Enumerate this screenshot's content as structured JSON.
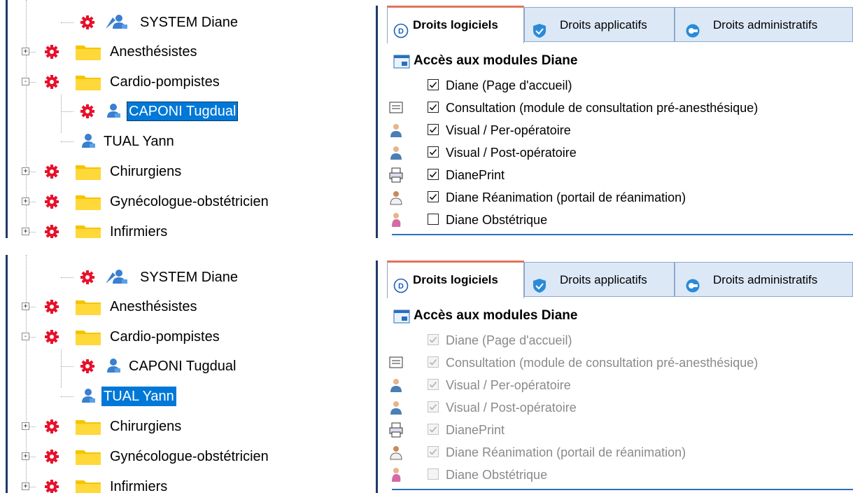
{
  "colors": {
    "selection": "#0078d7",
    "tab_accent": "#e2735a",
    "tab_inactive": "#dce8f6",
    "disabled_text": "#8a8a8a"
  },
  "panels": [
    {
      "tree": {
        "items": [
          {
            "label": "SYSTEM Diane",
            "icon": "admin-user-icon",
            "gear": true,
            "expander": "",
            "selected": false
          },
          {
            "label": "Anesthésistes",
            "icon": "folder-icon",
            "gear": true,
            "expander": "+",
            "selected": false
          },
          {
            "label": "Cardio-pompistes",
            "icon": "folder-icon",
            "gear": true,
            "expander": "-",
            "selected": false
          },
          {
            "label": "CAPONI Tugdual",
            "icon": "user-icon",
            "gear": true,
            "expander": "",
            "selected": true
          },
          {
            "label": "TUAL Yann",
            "icon": "user-icon",
            "gear": false,
            "expander": "",
            "selected": false
          },
          {
            "label": "Chirurgiens",
            "icon": "folder-icon",
            "gear": true,
            "expander": "+",
            "selected": false
          },
          {
            "label": "Gynécologue-obstétricien",
            "icon": "folder-icon",
            "gear": true,
            "expander": "+",
            "selected": false
          },
          {
            "label": "Infirmiers",
            "icon": "folder-icon",
            "gear": true,
            "expander": "+",
            "selected": false
          }
        ]
      },
      "tabs": [
        "Droits logiciels",
        "Droits applicatifs",
        "Droits administratifs"
      ],
      "section_title": "Accès aux modules Diane",
      "modules_enabled": true,
      "modules": [
        {
          "label": "Diane (Page d'accueil)",
          "checked": true,
          "icon": ""
        },
        {
          "label": "Consultation (module de consultation pré-anesthésique)",
          "checked": true,
          "icon": "consultation-icon"
        },
        {
          "label": "Visual / Per-opératoire",
          "checked": true,
          "icon": "surgeon-icon"
        },
        {
          "label": "Visual / Post-opératoire",
          "checked": true,
          "icon": "surgeon-icon"
        },
        {
          "label": "DianePrint",
          "checked": true,
          "icon": "printer-icon"
        },
        {
          "label": "Diane Réanimation (portail de réanimation)",
          "checked": true,
          "icon": "doctor-icon"
        },
        {
          "label": "Diane Obstétrique",
          "checked": false,
          "icon": "pregnant-icon"
        }
      ]
    },
    {
      "tree": {
        "items": [
          {
            "label": "SYSTEM Diane",
            "icon": "admin-user-icon",
            "gear": true,
            "expander": "",
            "selected": false
          },
          {
            "label": "Anesthésistes",
            "icon": "folder-icon",
            "gear": true,
            "expander": "+",
            "selected": false
          },
          {
            "label": "Cardio-pompistes",
            "icon": "folder-icon",
            "gear": true,
            "expander": "-",
            "selected": false
          },
          {
            "label": "CAPONI Tugdual",
            "icon": "user-icon",
            "gear": true,
            "expander": "",
            "selected": false
          },
          {
            "label": "TUAL Yann",
            "icon": "user-icon",
            "gear": false,
            "expander": "",
            "selected": true
          },
          {
            "label": "Chirurgiens",
            "icon": "folder-icon",
            "gear": true,
            "expander": "+",
            "selected": false
          },
          {
            "label": "Gynécologue-obstétricien",
            "icon": "folder-icon",
            "gear": true,
            "expander": "+",
            "selected": false
          },
          {
            "label": "Infirmiers",
            "icon": "folder-icon",
            "gear": true,
            "expander": "+",
            "selected": false
          }
        ]
      },
      "tabs": [
        "Droits logiciels",
        "Droits applicatifs",
        "Droits administratifs"
      ],
      "section_title": "Accès aux modules Diane",
      "modules_enabled": false,
      "modules": [
        {
          "label": "Diane (Page d'accueil)",
          "checked": true,
          "icon": ""
        },
        {
          "label": "Consultation (module de consultation pré-anesthésique)",
          "checked": true,
          "icon": "consultation-icon"
        },
        {
          "label": "Visual / Per-opératoire",
          "checked": true,
          "icon": "surgeon-icon"
        },
        {
          "label": "Visual / Post-opératoire",
          "checked": true,
          "icon": "surgeon-icon"
        },
        {
          "label": "DianePrint",
          "checked": true,
          "icon": "printer-icon"
        },
        {
          "label": "Diane Réanimation (portail de réanimation)",
          "checked": true,
          "icon": "doctor-icon"
        },
        {
          "label": "Diane Obstétrique",
          "checked": false,
          "icon": "pregnant-icon"
        }
      ]
    }
  ]
}
